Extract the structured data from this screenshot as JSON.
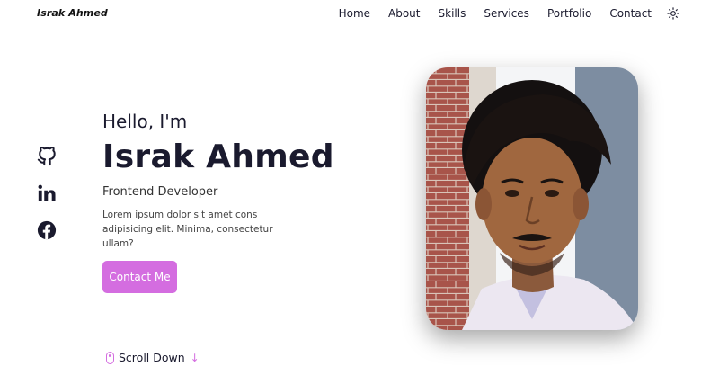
{
  "header": {
    "logo": "Israk Ahmed",
    "nav": [
      "Home",
      "About",
      "Skills",
      "Services",
      "Portfolio",
      "Contact"
    ],
    "theme_icon": "sun-icon"
  },
  "social": [
    "github-icon",
    "linkedin-icon",
    "facebook-icon"
  ],
  "hero": {
    "greeting": "Hello, I'm",
    "name": "Israk Ahmed",
    "role": "Frontend Developer",
    "description": "Lorem ipsum dolor sit amet cons adipisicing elit. Minima, consectetur ullam?",
    "cta": "Contact Me",
    "scroll_label": "Scroll Down",
    "accent": "#d46de0"
  }
}
